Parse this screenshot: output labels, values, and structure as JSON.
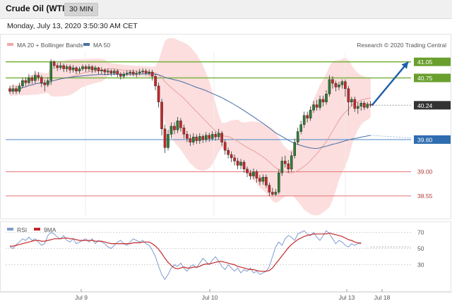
{
  "header": {
    "title": "Crude Oil (WTI)",
    "timeframe": "30 MIN",
    "timestamp": "Monday, July 13, 2020 3:50:30 AM CET"
  },
  "chart_data": [
    {
      "type": "candlestick",
      "legend": [
        {
          "name": "MA 20 + Bollinger Bands",
          "color": "#f2a8a8"
        },
        {
          "name": "MA 50",
          "color": "#4a6fa5"
        }
      ],
      "credit": "Research © 2020 Trading Central",
      "ylim": [
        38.18,
        41.23
      ],
      "x_tick_labels": [
        "Jul 9",
        "Jul 10",
        "Jul 13",
        "Jul 18"
      ],
      "current_price": {
        "value": 40.24,
        "label": "40.24"
      },
      "levels": [
        {
          "value": 41.05,
          "label": "41.05",
          "kind": "resistance",
          "color": "#7cb342"
        },
        {
          "value": 40.75,
          "label": "40.75",
          "kind": "resistance",
          "color": "#7cb342"
        },
        {
          "value": 39.6,
          "label": "39.60",
          "kind": "pivot",
          "color": "#4a86c8"
        },
        {
          "value": 39.0,
          "label": "39.00",
          "kind": "support",
          "color": "#e57373"
        },
        {
          "value": 38.55,
          "label": "38.55",
          "kind": "support",
          "color": "#e57373"
        }
      ],
      "forecast_arrow": {
        "from": 40.24,
        "to": 41.05,
        "color": "#1f5fa8"
      },
      "candles": [
        [
          40.55,
          40.5,
          40.6,
          40.45
        ],
        [
          40.5,
          40.55,
          40.62,
          40.45
        ],
        [
          40.55,
          40.5,
          40.6,
          40.45
        ],
        [
          40.5,
          40.6,
          40.66,
          40.46
        ],
        [
          40.6,
          40.7,
          40.75,
          40.56
        ],
        [
          40.7,
          40.66,
          40.76,
          40.6
        ],
        [
          40.66,
          40.75,
          40.82,
          40.62
        ],
        [
          40.75,
          40.7,
          40.8,
          40.64
        ],
        [
          40.7,
          40.8,
          40.88,
          40.65
        ],
        [
          40.8,
          40.76,
          40.86,
          40.7
        ],
        [
          40.76,
          40.66,
          40.8,
          40.58
        ],
        [
          40.66,
          40.62,
          40.72,
          40.5
        ],
        [
          40.62,
          40.7,
          40.76,
          40.58
        ],
        [
          40.7,
          41.05,
          41.1,
          40.62
        ],
        [
          41.05,
          40.98,
          41.08,
          40.92
        ],
        [
          40.98,
          40.94,
          41.03,
          40.88
        ],
        [
          40.94,
          40.98,
          41.04,
          40.9
        ],
        [
          40.98,
          40.92,
          41.02,
          40.86
        ],
        [
          40.92,
          40.96,
          41.0,
          40.86
        ],
        [
          40.96,
          40.9,
          41.0,
          40.84
        ],
        [
          40.9,
          40.94,
          40.99,
          40.85
        ],
        [
          40.94,
          40.88,
          40.97,
          40.82
        ],
        [
          40.88,
          40.92,
          40.96,
          40.83
        ],
        [
          40.92,
          40.96,
          41.0,
          40.88
        ],
        [
          40.96,
          40.92,
          41.0,
          40.86
        ],
        [
          40.92,
          40.96,
          41.01,
          40.87
        ],
        [
          40.96,
          40.9,
          40.99,
          40.84
        ],
        [
          40.9,
          40.94,
          40.98,
          40.85
        ],
        [
          40.94,
          40.88,
          40.96,
          40.82
        ],
        [
          40.88,
          40.9,
          40.95,
          40.82
        ],
        [
          40.9,
          40.86,
          40.93,
          40.8
        ],
        [
          40.86,
          40.88,
          40.93,
          40.8
        ],
        [
          40.88,
          40.84,
          40.91,
          40.78
        ],
        [
          40.84,
          40.88,
          40.92,
          40.8
        ],
        [
          40.88,
          40.82,
          40.91,
          40.76
        ],
        [
          40.82,
          40.78,
          40.86,
          40.72
        ],
        [
          40.78,
          40.82,
          40.87,
          40.74
        ],
        [
          40.82,
          40.84,
          40.89,
          40.78
        ],
        [
          40.84,
          40.86,
          40.9,
          40.79
        ],
        [
          40.86,
          40.82,
          40.91,
          40.78
        ],
        [
          40.82,
          40.84,
          40.89,
          40.76
        ],
        [
          40.84,
          40.86,
          40.92,
          40.8
        ],
        [
          40.86,
          40.88,
          40.93,
          40.82
        ],
        [
          40.88,
          40.84,
          40.92,
          40.8
        ],
        [
          40.84,
          40.86,
          40.91,
          40.79
        ],
        [
          40.86,
          40.78,
          40.9,
          40.7
        ],
        [
          40.78,
          40.6,
          40.82,
          40.52
        ],
        [
          40.6,
          40.3,
          40.66,
          40.2
        ],
        [
          40.3,
          39.8,
          40.36,
          39.68
        ],
        [
          39.8,
          39.45,
          39.88,
          39.35
        ],
        [
          39.45,
          39.7,
          39.78,
          39.4
        ],
        [
          39.7,
          39.85,
          39.92,
          39.62
        ],
        [
          39.85,
          39.78,
          39.92,
          39.7
        ],
        [
          39.78,
          39.95,
          40.02,
          39.72
        ],
        [
          39.95,
          39.82,
          40.0,
          39.75
        ],
        [
          39.82,
          39.7,
          39.88,
          39.62
        ],
        [
          39.7,
          39.62,
          39.76,
          39.55
        ],
        [
          39.62,
          39.55,
          39.7,
          39.48
        ],
        [
          39.55,
          39.65,
          39.72,
          39.5
        ],
        [
          39.65,
          39.58,
          39.7,
          39.52
        ],
        [
          39.58,
          39.66,
          39.72,
          39.52
        ],
        [
          39.66,
          39.6,
          39.7,
          39.54
        ],
        [
          39.6,
          39.68,
          39.74,
          39.55
        ],
        [
          39.68,
          39.62,
          39.73,
          39.56
        ],
        [
          39.62,
          39.7,
          39.76,
          39.58
        ],
        [
          39.7,
          39.65,
          39.75,
          39.58
        ],
        [
          39.65,
          39.72,
          39.8,
          39.6
        ],
        [
          39.72,
          39.55,
          39.76,
          39.48
        ],
        [
          39.55,
          39.4,
          39.6,
          39.32
        ],
        [
          39.4,
          39.32,
          39.45,
          39.25
        ],
        [
          39.32,
          39.26,
          39.38,
          39.18
        ],
        [
          39.26,
          39.2,
          39.32,
          39.12
        ],
        [
          39.2,
          39.12,
          39.26,
          39.05
        ],
        [
          39.12,
          39.18,
          39.24,
          39.05
        ],
        [
          39.18,
          39.05,
          39.22,
          38.98
        ],
        [
          39.05,
          38.98,
          39.1,
          38.9
        ],
        [
          38.98,
          38.92,
          39.04,
          38.85
        ],
        [
          38.92,
          39.0,
          39.06,
          38.86
        ],
        [
          39.0,
          38.88,
          39.04,
          38.8
        ],
        [
          38.88,
          38.82,
          38.94,
          38.75
        ],
        [
          38.82,
          38.9,
          38.95,
          38.76
        ],
        [
          38.9,
          38.75,
          38.95,
          38.7
        ],
        [
          38.75,
          38.62,
          38.8,
          38.55
        ],
        [
          38.62,
          38.58,
          38.7,
          38.55
        ],
        [
          38.58,
          38.62,
          38.68,
          38.55
        ],
        [
          38.62,
          38.98,
          39.05,
          38.58
        ],
        [
          38.98,
          39.2,
          39.28,
          38.92
        ],
        [
          39.2,
          39.15,
          39.3,
          39.08
        ],
        [
          39.15,
          39.05,
          39.22,
          38.98
        ],
        [
          39.05,
          39.3,
          39.38,
          39.0
        ],
        [
          39.3,
          39.55,
          39.62,
          39.25
        ],
        [
          39.55,
          39.75,
          39.82,
          39.5
        ],
        [
          39.75,
          39.88,
          39.95,
          39.7
        ],
        [
          39.88,
          40.05,
          40.12,
          39.82
        ],
        [
          40.05,
          40.0,
          40.12,
          39.92
        ],
        [
          40.0,
          40.15,
          40.22,
          39.95
        ],
        [
          40.15,
          40.25,
          40.32,
          40.1
        ],
        [
          40.25,
          40.2,
          40.34,
          40.14
        ],
        [
          40.2,
          40.35,
          40.42,
          40.15
        ],
        [
          40.35,
          40.3,
          40.42,
          40.22
        ],
        [
          40.3,
          40.45,
          40.52,
          40.25
        ],
        [
          40.45,
          40.72,
          40.8,
          40.4
        ],
        [
          40.72,
          40.65,
          40.78,
          40.55
        ],
        [
          40.65,
          40.58,
          40.7,
          40.5
        ],
        [
          40.58,
          40.62,
          40.68,
          40.52
        ],
        [
          40.62,
          40.68,
          40.72,
          40.55
        ],
        [
          40.68,
          40.55,
          40.72,
          40.4
        ],
        [
          40.55,
          40.3,
          40.6,
          40.05
        ],
        [
          40.3,
          40.35,
          40.4,
          40.22
        ],
        [
          40.35,
          40.18,
          40.4,
          40.12
        ],
        [
          40.18,
          40.22,
          40.3,
          40.08
        ],
        [
          40.22,
          40.28,
          40.32,
          40.14
        ],
        [
          40.28,
          40.2,
          40.32,
          40.15
        ],
        [
          40.2,
          40.26,
          40.3,
          40.17
        ],
        [
          40.26,
          40.24,
          40.32,
          40.2
        ]
      ]
    },
    {
      "type": "line",
      "ylim": [
        0,
        80
      ],
      "y_ticks": [
        30,
        50,
        70
      ],
      "legend": [
        {
          "name": "RSI",
          "color": "#7f9ccf"
        },
        {
          "name": "9MA",
          "color": "#c62828"
        }
      ],
      "series": [
        {
          "name": "RSI",
          "color": "#7f9ccf",
          "values": [
            52,
            50,
            55,
            58,
            62,
            60,
            64,
            60,
            62,
            58,
            54,
            56,
            66,
            70,
            68,
            64,
            62,
            66,
            60,
            58,
            62,
            56,
            58,
            60,
            62,
            58,
            62,
            56,
            60,
            58,
            56,
            52,
            50,
            54,
            58,
            60,
            56,
            54,
            58,
            62,
            60,
            58,
            60,
            56,
            54,
            48,
            40,
            28,
            18,
            12,
            18,
            26,
            30,
            28,
            32,
            26,
            22,
            28,
            30,
            26,
            32,
            38,
            34,
            30,
            36,
            40,
            34,
            28,
            24,
            30,
            26,
            22,
            26,
            20,
            24,
            22,
            26,
            20,
            22,
            18,
            20,
            22,
            28,
            40,
            52,
            58,
            54,
            62,
            66,
            64,
            60,
            68,
            70,
            72,
            68,
            66,
            70,
            64,
            60,
            66,
            72,
            68,
            62,
            56,
            60,
            58,
            54,
            52,
            56,
            54,
            56,
            58
          ]
        },
        {
          "name": "9MA",
          "color": "#c62828",
          "values": [
            53,
            53,
            54,
            55,
            56,
            57,
            58,
            59,
            60,
            60,
            59,
            59,
            60,
            61,
            62,
            62,
            62,
            63,
            63,
            62,
            62,
            61,
            60,
            60,
            60,
            60,
            60,
            59,
            59,
            59,
            58,
            57,
            56,
            56,
            56,
            56,
            56,
            56,
            56,
            57,
            57,
            57,
            58,
            58,
            58,
            56,
            53,
            49,
            44,
            38,
            33,
            29,
            26,
            25,
            26,
            27,
            26,
            26,
            27,
            27,
            28,
            30,
            31,
            31,
            32,
            33,
            34,
            34,
            33,
            32,
            31,
            30,
            28,
            27,
            26,
            25,
            24,
            24,
            23,
            22,
            22,
            22,
            23,
            26,
            31,
            36,
            41,
            46,
            51,
            55,
            58,
            61,
            63,
            65,
            66,
            67,
            68,
            68,
            68,
            68,
            68,
            69,
            68,
            67,
            66,
            65,
            63,
            61,
            60,
            58,
            57,
            56
          ]
        }
      ],
      "reference_line": 52
    }
  ]
}
